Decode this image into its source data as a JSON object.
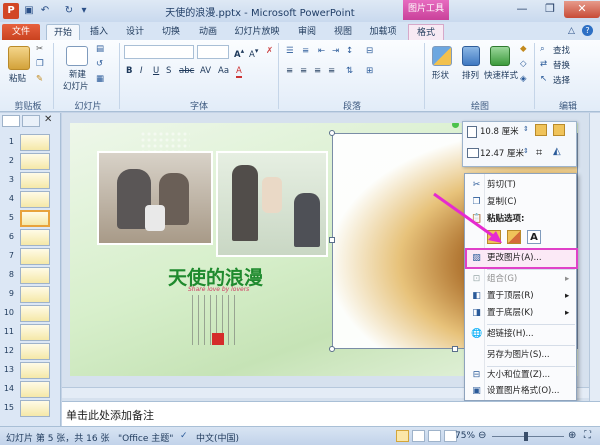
{
  "window": {
    "title": "天使的浪漫.pptx - Microsoft PowerPoint",
    "context_tab_group": "图片工具"
  },
  "tabs": [
    "文件",
    "开始",
    "插入",
    "设计",
    "切换",
    "动画",
    "幻灯片放映",
    "审阅",
    "视图",
    "加载项",
    "格式"
  ],
  "ribbon": {
    "clipboard": {
      "paste": "粘贴",
      "label": "剪贴板"
    },
    "slides": {
      "new_slide": "新建",
      "new_slide2": "幻灯片",
      "label": "幻灯片"
    },
    "font": {
      "label": "字体"
    },
    "paragraph": {
      "label": "段落"
    },
    "drawing": {
      "shapes": "形状",
      "arrange": "排列",
      "quick_styles": "快速样式",
      "label": "绘图"
    },
    "editing": {
      "find": "查找",
      "replace": "替换",
      "select": "选择",
      "label": "编辑"
    }
  },
  "thumbnails": [
    "1",
    "2",
    "3",
    "4",
    "5",
    "6",
    "7",
    "8",
    "9",
    "10",
    "11",
    "12",
    "13",
    "14",
    "15"
  ],
  "selected_slide": "5",
  "slide": {
    "title_art": "天使的浪漫",
    "subtitle_art": "Share love by lovers"
  },
  "mini_toolbar": {
    "height_value": "10.8 厘米",
    "width_value": "12.47 厘米"
  },
  "context_menu": {
    "items": [
      {
        "label": "剪切(T)",
        "icon": "scissors-icon",
        "disabled": false
      },
      {
        "label": "复制(C)",
        "icon": "copy-icon",
        "disabled": false
      },
      {
        "label": "粘贴选项:",
        "icon": "paste-icon",
        "disabled": false
      },
      {
        "label": "更改图片(A)...",
        "icon": "change-picture-icon",
        "disabled": false
      },
      {
        "label": "组合(G)",
        "icon": "group-icon",
        "disabled": true
      },
      {
        "label": "置于顶层(R)",
        "icon": "bring-front-icon",
        "disabled": false
      },
      {
        "label": "置于底层(K)",
        "icon": "send-back-icon",
        "disabled": false
      },
      {
        "label": "超链接(H)...",
        "icon": "hyperlink-icon",
        "disabled": false
      },
      {
        "label": "另存为图片(S)...",
        "icon": "save-picture-icon",
        "disabled": false
      },
      {
        "label": "大小和位置(Z)...",
        "icon": "size-icon",
        "disabled": false
      },
      {
        "label": "设置图片格式(O)...",
        "icon": "format-picture-icon",
        "disabled": false
      }
    ]
  },
  "notes": {
    "placeholder": "单击此处添加备注"
  },
  "statusbar": {
    "slide_info": "幻灯片 第 5 张，共 16 张",
    "theme": "\"Office 主题\"",
    "language": "中文(中国)",
    "zoom": "75%"
  }
}
